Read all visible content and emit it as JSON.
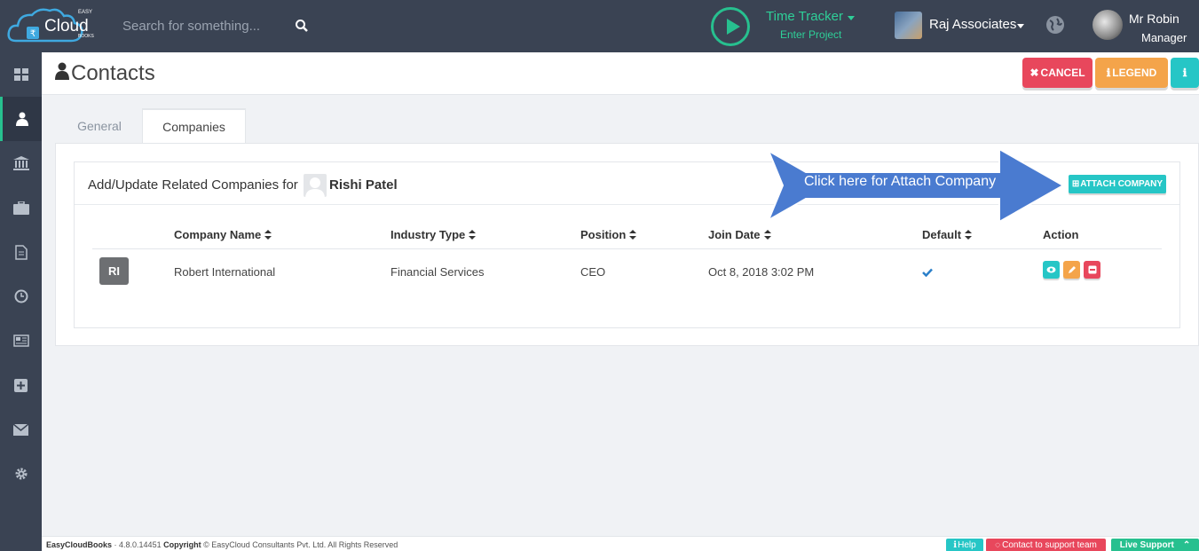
{
  "header": {
    "logo_easy": "EASY",
    "logo_cloud": "Cloud",
    "logo_books": "BOOKS",
    "search_placeholder": "Search for something...",
    "time_tracker_title": "Time Tracker",
    "time_tracker_sub": "Enter Project",
    "org_name": "Raj Associates",
    "user_name": "Mr Robin",
    "user_role": "Manager"
  },
  "sidebar": {
    "items": [
      {
        "icon": "dashboard-icon"
      },
      {
        "icon": "user-icon",
        "active": true
      },
      {
        "icon": "bank-icon"
      },
      {
        "icon": "briefcase-icon"
      },
      {
        "icon": "document-icon"
      },
      {
        "icon": "clock-icon"
      },
      {
        "icon": "newspaper-icon"
      },
      {
        "icon": "plus-square-icon"
      },
      {
        "icon": "envelope-icon"
      },
      {
        "icon": "gear-icon"
      }
    ]
  },
  "page": {
    "title": "Contacts",
    "cancel_label": "CANCEL",
    "legend_label": "LEGEND"
  },
  "tabs": {
    "general": "General",
    "companies": "Companies"
  },
  "panel": {
    "title": "Add/Update Related Companies for",
    "contact_name": "Rishi Patel",
    "attach_label": "ATTACH COMPANY",
    "callout": "Click here for Attach Company"
  },
  "table": {
    "columns": [
      "Company Name",
      "Industry Type",
      "Position",
      "Join Date",
      "Default",
      "Action"
    ],
    "rows": [
      {
        "initials": "RI",
        "company": "Robert International",
        "industry": "Financial Services",
        "position": "CEO",
        "join_date": "Oct 8, 2018 3:02 PM",
        "default": true
      }
    ]
  },
  "footer": {
    "app": "EasyCloudBooks",
    "version": " · 4.8.0.14451 ",
    "copyright_label": "Copyright",
    "copyright_text": " © EasyCloud Consultants Pvt. Ltd. All Rights Reserved",
    "help": "Help",
    "contact_support": "Contact to support team",
    "live_support": "Live Support"
  },
  "colors": {
    "topbar": "#3a4353",
    "accent_green": "#27c08f",
    "cyan": "#26c6c6",
    "red": "#e8475c",
    "orange": "#f4a44a",
    "callout_blue": "#4a7bd0"
  }
}
